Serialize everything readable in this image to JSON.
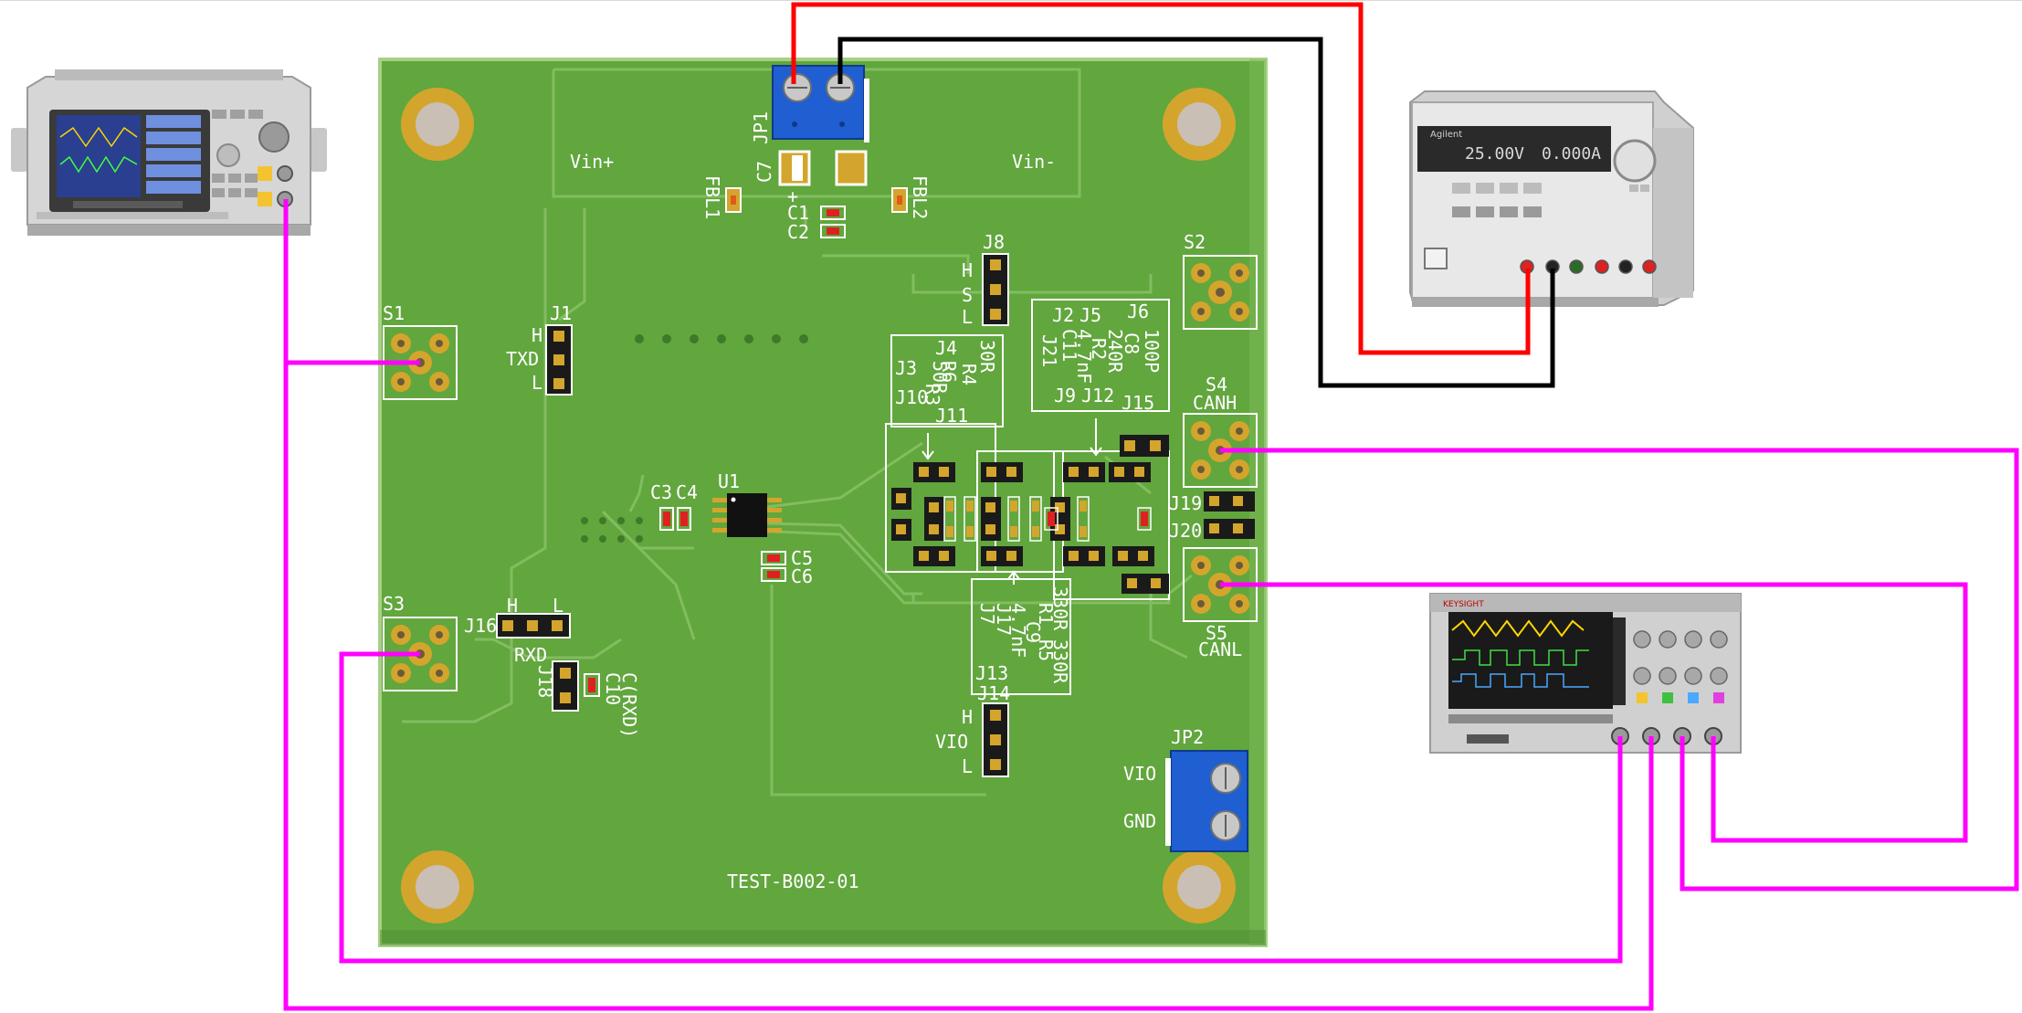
{
  "board": {
    "id": "TEST-B002-01",
    "vin_plus": "Vin+",
    "vin_minus": "Vin-",
    "colors": {
      "pcb": "#62a63e",
      "pcb_dark": "#4f8c34",
      "silk": "#ffffff",
      "pad": "#d4a52c",
      "terminal": "#1f5fd1"
    }
  },
  "labels": {
    "jp1": "JP1",
    "c7": "C7",
    "fbl1": "FBL1",
    "fbl2": "FBL2",
    "c1": "C1",
    "c2": "C2",
    "plus": "+",
    "s1": "S1",
    "s2": "S2",
    "s3": "S3",
    "s4": "S4",
    "s5": "S5",
    "canh": "CANH",
    "canl": "CANL",
    "j1": "J1",
    "j1_h": "H",
    "j1_txd": "TXD",
    "j1_l": "L",
    "j8": "J8",
    "j8_h": "H",
    "j8_s": "S",
    "j8_l": "L",
    "j16": "J16",
    "j16_h": "H",
    "j16_l": "L",
    "rxd": "RXD",
    "j18": "J18",
    "c10": "C10",
    "c_rxd": "C(RXD)",
    "u1": "U1",
    "c3": "C3",
    "c4": "C4",
    "c5": "C5",
    "c6": "C6",
    "j3": "J3",
    "j4": "J4",
    "r6": "R6",
    "r4": "R4",
    "r3": "R3",
    "r50": "50R",
    "r30": "30R",
    "j10": "J10",
    "j11": "J11",
    "j2": "J2",
    "j5": "J5",
    "j6": "J6",
    "c8": "C8",
    "c100p": "100P",
    "r240": "240R",
    "r2": "R2",
    "c11": "C11",
    "c47": "4.7nF",
    "j21": "J21",
    "j9": "J9",
    "j12": "J12",
    "j15": "J15",
    "j19": "J19",
    "j20": "J20",
    "j7": "J7",
    "r1": "R1",
    "r5": "R5",
    "r330a": "330R",
    "r330b": "330R",
    "c9": "C9",
    "c47b": "4.7nF",
    "j17": "J17",
    "j13": "J13",
    "j14": "J14",
    "j14_h": "H",
    "j14_vio": "VIO",
    "j14_l": "L",
    "jp2": "JP2",
    "vio": "VIO",
    "gnd": "GND"
  },
  "instruments": {
    "generator": {
      "name": "function-generator"
    },
    "power_supply": {
      "brand": "Agilent",
      "voltage": "25.00V",
      "current": "0.000A"
    },
    "oscilloscope": {
      "brand": "KEYSIGHT"
    }
  },
  "wires": {
    "power_positive": "#ff0000",
    "power_negative": "#000000",
    "signal": "#ff00ff"
  }
}
